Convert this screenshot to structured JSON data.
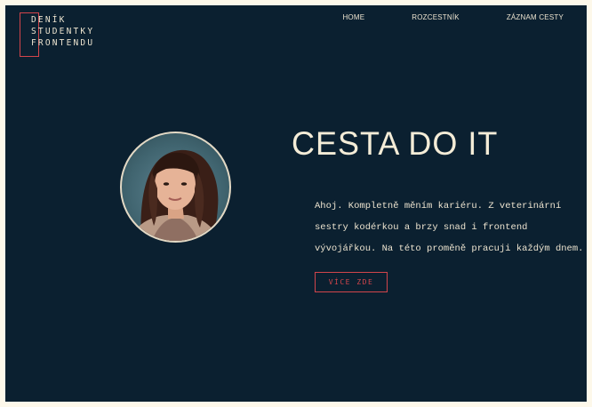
{
  "logo": {
    "lines": [
      "DENÍK",
      "STUDENTKY",
      "FRONTENDU"
    ],
    "box_color": "#d2454b"
  },
  "nav": {
    "items": [
      {
        "label": "HOME"
      },
      {
        "label": "ROZCESTNÍK"
      },
      {
        "label": "ZÁZNAM CESTY"
      }
    ]
  },
  "hero": {
    "title": "CESTA DO IT",
    "intro": "Ahoj. Kompletně měním kariéru. Z veterinární sestry kodérkou a brzy snad i frontend vývojářkou. Na této proměně pracuji každým dnem.",
    "cta_label": "VÍCE ZDE"
  },
  "colors": {
    "background": "#0b2030",
    "text": "#ece3cf",
    "accent": "#d2454b"
  },
  "icons": {
    "avatar": "portrait-photo"
  }
}
